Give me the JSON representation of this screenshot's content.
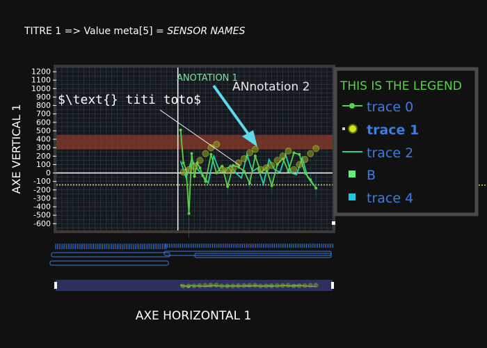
{
  "chart_data": {
    "type": "line",
    "title_prefix": "TITRE 1 => Value meta[5] = ",
    "title_italic": "SENSOR NAMES",
    "xlabel": "AXE HORIZONTAL 1",
    "ylabel": "AXE VERTICAL 1",
    "ylim": [
      -680,
      1250
    ],
    "y_ticks": [
      1200,
      1100,
      1000,
      900,
      800,
      700,
      600,
      500,
      400,
      300,
      200,
      100,
      0,
      -100,
      -200,
      -300,
      -400,
      -500,
      -600
    ],
    "x_range": [
      -44,
      56
    ],
    "reference_lines": {
      "vertical_x": 0,
      "horizontal_y": 0,
      "dotted_y": -140
    },
    "band": {
      "y0": 280,
      "y1": 450,
      "color": "#8b3a2a"
    },
    "legend": {
      "title": "THIS IS THE LEGEND",
      "placement": "top-right, outside plot",
      "entries": [
        {
          "label": "trace 0",
          "color": "#5bd14a",
          "symbol": "line-dot"
        },
        {
          "label": "trace 1",
          "color": "#d4e21a",
          "symbol": "dot",
          "bold": true
        },
        {
          "label": "trace 2",
          "color": "#1fd3a4",
          "symbol": "line"
        },
        {
          "label": "B",
          "color": "#5bf27a",
          "symbol": "square"
        },
        {
          "label": "trace 4",
          "color": "#1ec8e8",
          "symbol": "square"
        }
      ]
    },
    "series": [
      {
        "name": "trace 0",
        "color": "#5bd14a",
        "x": [
          1,
          2,
          3,
          4,
          5,
          6,
          7,
          8,
          9,
          10,
          12,
          14,
          16,
          18,
          20,
          22,
          24,
          26,
          28,
          30,
          32,
          34,
          36,
          38,
          40,
          42,
          44,
          46,
          48,
          50
        ],
        "y": [
          510,
          120,
          40,
          -480,
          230,
          -40,
          120,
          60,
          -30,
          -100,
          220,
          0,
          80,
          -160,
          90,
          70,
          20,
          -120,
          200,
          10,
          60,
          -150,
          100,
          170,
          20,
          240,
          220,
          0,
          -80,
          -180
        ]
      },
      {
        "name": "trace 1",
        "color": "#d4e21a",
        "x": [
          2,
          4,
          6,
          8,
          10,
          12,
          14,
          16,
          18,
          20,
          22,
          24,
          26,
          28,
          30,
          32,
          34,
          36,
          38,
          40,
          42,
          44,
          46,
          48,
          50
        ],
        "y": [
          10,
          40,
          80,
          150,
          230,
          300,
          340,
          40,
          30,
          50,
          120,
          170,
          240,
          280,
          40,
          60,
          90,
          150,
          200,
          260,
          40,
          100,
          160,
          230,
          290
        ]
      },
      {
        "name": "trace 2",
        "color": "#1fd3a4",
        "x": [
          1,
          3,
          5,
          7,
          9,
          11,
          13,
          15,
          17,
          19,
          21,
          23,
          25,
          27,
          29,
          31,
          33,
          35,
          37,
          39,
          41,
          43,
          45,
          47,
          49
        ],
        "y": [
          140,
          -60,
          160,
          50,
          -30,
          -120,
          200,
          30,
          10,
          90,
          0,
          -60,
          220,
          20,
          60,
          -130,
          160,
          40,
          10,
          220,
          0,
          -20,
          180,
          -50,
          -140
        ]
      }
    ],
    "annotations": [
      {
        "text": "ANOTATION 1",
        "color": "#7de0a8"
      },
      {
        "text": "ANnotation 2",
        "color": "#e8e8e8"
      },
      {
        "text": "$\\text{} titi toto$",
        "color": "#ffffff"
      }
    ]
  }
}
